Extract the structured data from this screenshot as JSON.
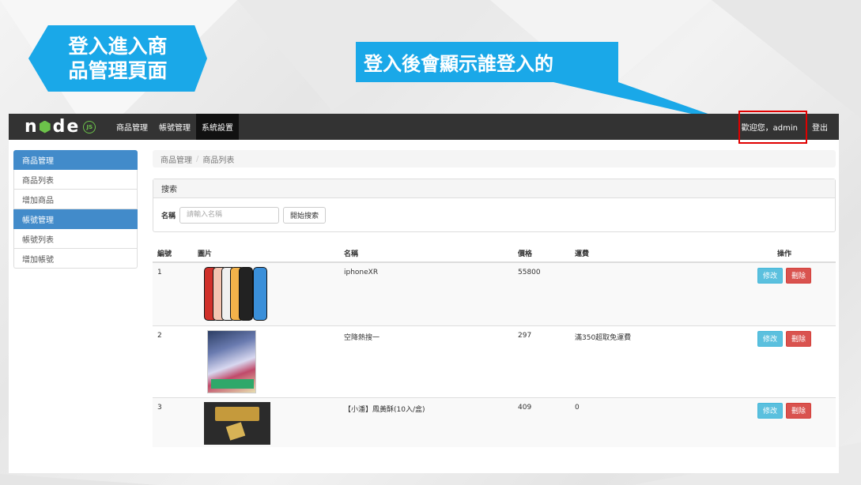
{
  "annotations": {
    "left_callout": "登入進入商品管理頁面",
    "right_callout": "登入後會顯示誰登入的"
  },
  "navbar": {
    "brand_icon": "nodejs-logo-icon",
    "items": [
      {
        "label": "商品管理"
      },
      {
        "label": "帳號管理"
      },
      {
        "label": "系統設置"
      }
    ],
    "welcome": "歡迎您，admin",
    "logout": "登出"
  },
  "sidebar": {
    "sections": [
      {
        "title": "商品管理",
        "items": [
          "商品列表",
          "增加商品"
        ]
      },
      {
        "title": "帳號管理",
        "items": [
          "帳號列表",
          "增加帳號"
        ]
      }
    ]
  },
  "breadcrumb": {
    "root": "商品管理",
    "separator": "/",
    "current": "商品列表"
  },
  "search": {
    "panel_title": "搜索",
    "name_label": "名稱",
    "placeholder": "請輸入名稱",
    "button": "開始搜索"
  },
  "table": {
    "headers": {
      "no": "編號",
      "image": "圖片",
      "name": "名稱",
      "price": "價格",
      "shipping": "運費",
      "op": "操作"
    },
    "edit_label": "修改",
    "delete_label": "刪除",
    "rows": [
      {
        "no": "1",
        "name": "iphoneXR",
        "price": "55800",
        "shipping": "",
        "image": "iphone-xr-product-image"
      },
      {
        "no": "2",
        "name": "空降熱搜一",
        "price": "297",
        "shipping": "滿350超取免運費",
        "image": "book-cover-product-image"
      },
      {
        "no": "3",
        "name": "【小潘】鳳黃酥(10入/盒)",
        "price": "409",
        "shipping": "0",
        "image": "pastry-box-product-image"
      }
    ]
  },
  "colors": {
    "callout": "#1aa8e8",
    "navbar": "#333333",
    "sidebar_head": "#428bca",
    "highlight": "#e00000",
    "edit_button": "#5bc0de",
    "delete_button": "#d9534f"
  }
}
